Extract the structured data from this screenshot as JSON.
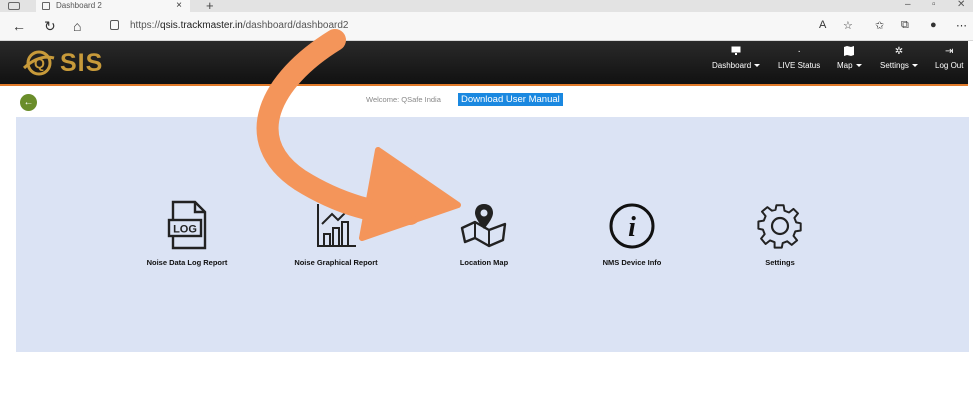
{
  "browser": {
    "tab_title": "Dashboard 2",
    "tab_close": "×",
    "new_tab": "+",
    "url_protocol": "https://",
    "url_host": "qsis.trackmaster.in",
    "url_path": "/dashboard/dashboard2",
    "win_minimize": "–",
    "win_maximize": "▫",
    "win_close": "✕"
  },
  "app": {
    "logo_text": "SIS",
    "nav": [
      {
        "label": "Dashboard",
        "icon": "monitor-icon",
        "has_caret": true
      },
      {
        "label": "LIVE Status",
        "icon": "",
        "has_caret": false
      },
      {
        "label": "Map",
        "icon": "map-icon",
        "has_caret": true
      },
      {
        "label": "Settings",
        "icon": "gear-icon",
        "has_caret": true
      },
      {
        "label": "Log Out",
        "icon": "logout-icon",
        "has_caret": false
      }
    ]
  },
  "subheader": {
    "welcome": "Welcome: QSafe India",
    "manual_link": "Download User Manual"
  },
  "tiles": [
    {
      "label": "Noise Data Log Report",
      "icon": "log-file-icon",
      "icon_text": "LOG"
    },
    {
      "label": "Noise Graphical Report",
      "icon": "bar-chart-icon"
    },
    {
      "label": "Location Map",
      "icon": "location-map-icon"
    },
    {
      "label": "NMS Device Info",
      "icon": "info-icon",
      "icon_text": "i"
    },
    {
      "label": "Settings",
      "icon": "gear-icon"
    }
  ],
  "colors": {
    "appbar": "#1a1a1a",
    "accent": "#e07a2a",
    "logo": "#c79a3a",
    "panel": "#dbe3f4",
    "manual_link_bg": "#1a88e0",
    "back_button": "#6a8d2a",
    "annotation_arrow": "#f4955a"
  }
}
